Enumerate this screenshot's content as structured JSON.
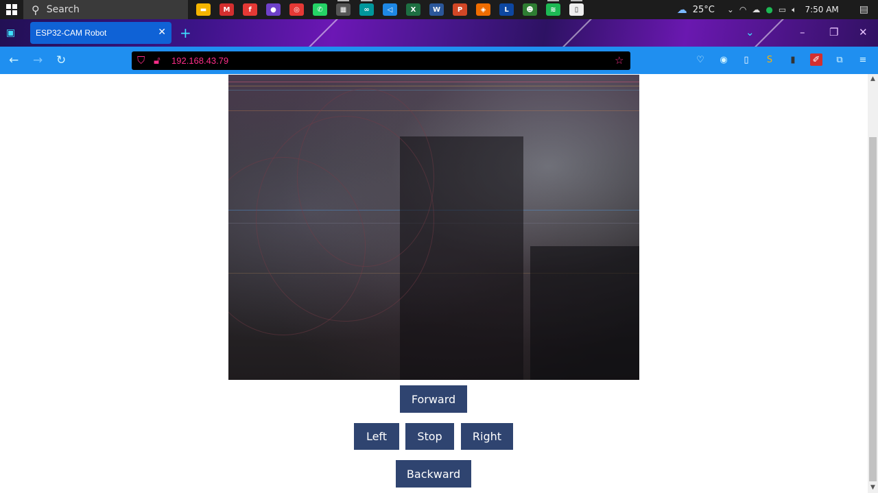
{
  "taskbar": {
    "search_label": "Search",
    "apps": [
      {
        "name": "file-explorer-icon",
        "color": "#f4b400",
        "glyph": "▬"
      },
      {
        "name": "mega-icon",
        "color": "#d32f2f",
        "glyph": "M"
      },
      {
        "name": "foxit-icon",
        "color": "#e53935",
        "glyph": "f"
      },
      {
        "name": "github-icon",
        "color": "#6e40c9",
        "glyph": "●"
      },
      {
        "name": "chrome-icon",
        "color": "#e53935",
        "glyph": "◎"
      },
      {
        "name": "whatsapp-icon",
        "color": "#25d366",
        "glyph": "✆"
      },
      {
        "name": "clapper-icon",
        "color": "#555555",
        "glyph": "▦"
      },
      {
        "name": "arduino-icon",
        "color": "#00979c",
        "glyph": "∞"
      },
      {
        "name": "vscode-icon",
        "color": "#1e88e5",
        "glyph": "◁"
      },
      {
        "name": "excel-icon",
        "color": "#1d6f42",
        "glyph": "X"
      },
      {
        "name": "word-icon",
        "color": "#2b579a",
        "glyph": "W"
      },
      {
        "name": "powerpoint-icon",
        "color": "#d24726",
        "glyph": "P"
      },
      {
        "name": "app-orange-icon",
        "color": "#ef6c00",
        "glyph": "◈"
      },
      {
        "name": "app-l-icon",
        "color": "#0d47a1",
        "glyph": "L"
      },
      {
        "name": "app-green-icon",
        "color": "#2e7d32",
        "glyph": "☻"
      },
      {
        "name": "spotify-icon",
        "color": "#1db954",
        "glyph": "≋"
      },
      {
        "name": "notepad-icon",
        "color": "#eeeeee",
        "glyph": "▯"
      }
    ],
    "weather_temp": "25°C",
    "time": "7:50 AM"
  },
  "browser": {
    "tab_title": "ESP32-CAM Robot",
    "url": "192.168.43.79",
    "accent": "#1f8ff0"
  },
  "controls": {
    "forward": "Forward",
    "left": "Left",
    "stop": "Stop",
    "right": "Right",
    "backward": "Backward",
    "button_color": "#2f4470"
  }
}
